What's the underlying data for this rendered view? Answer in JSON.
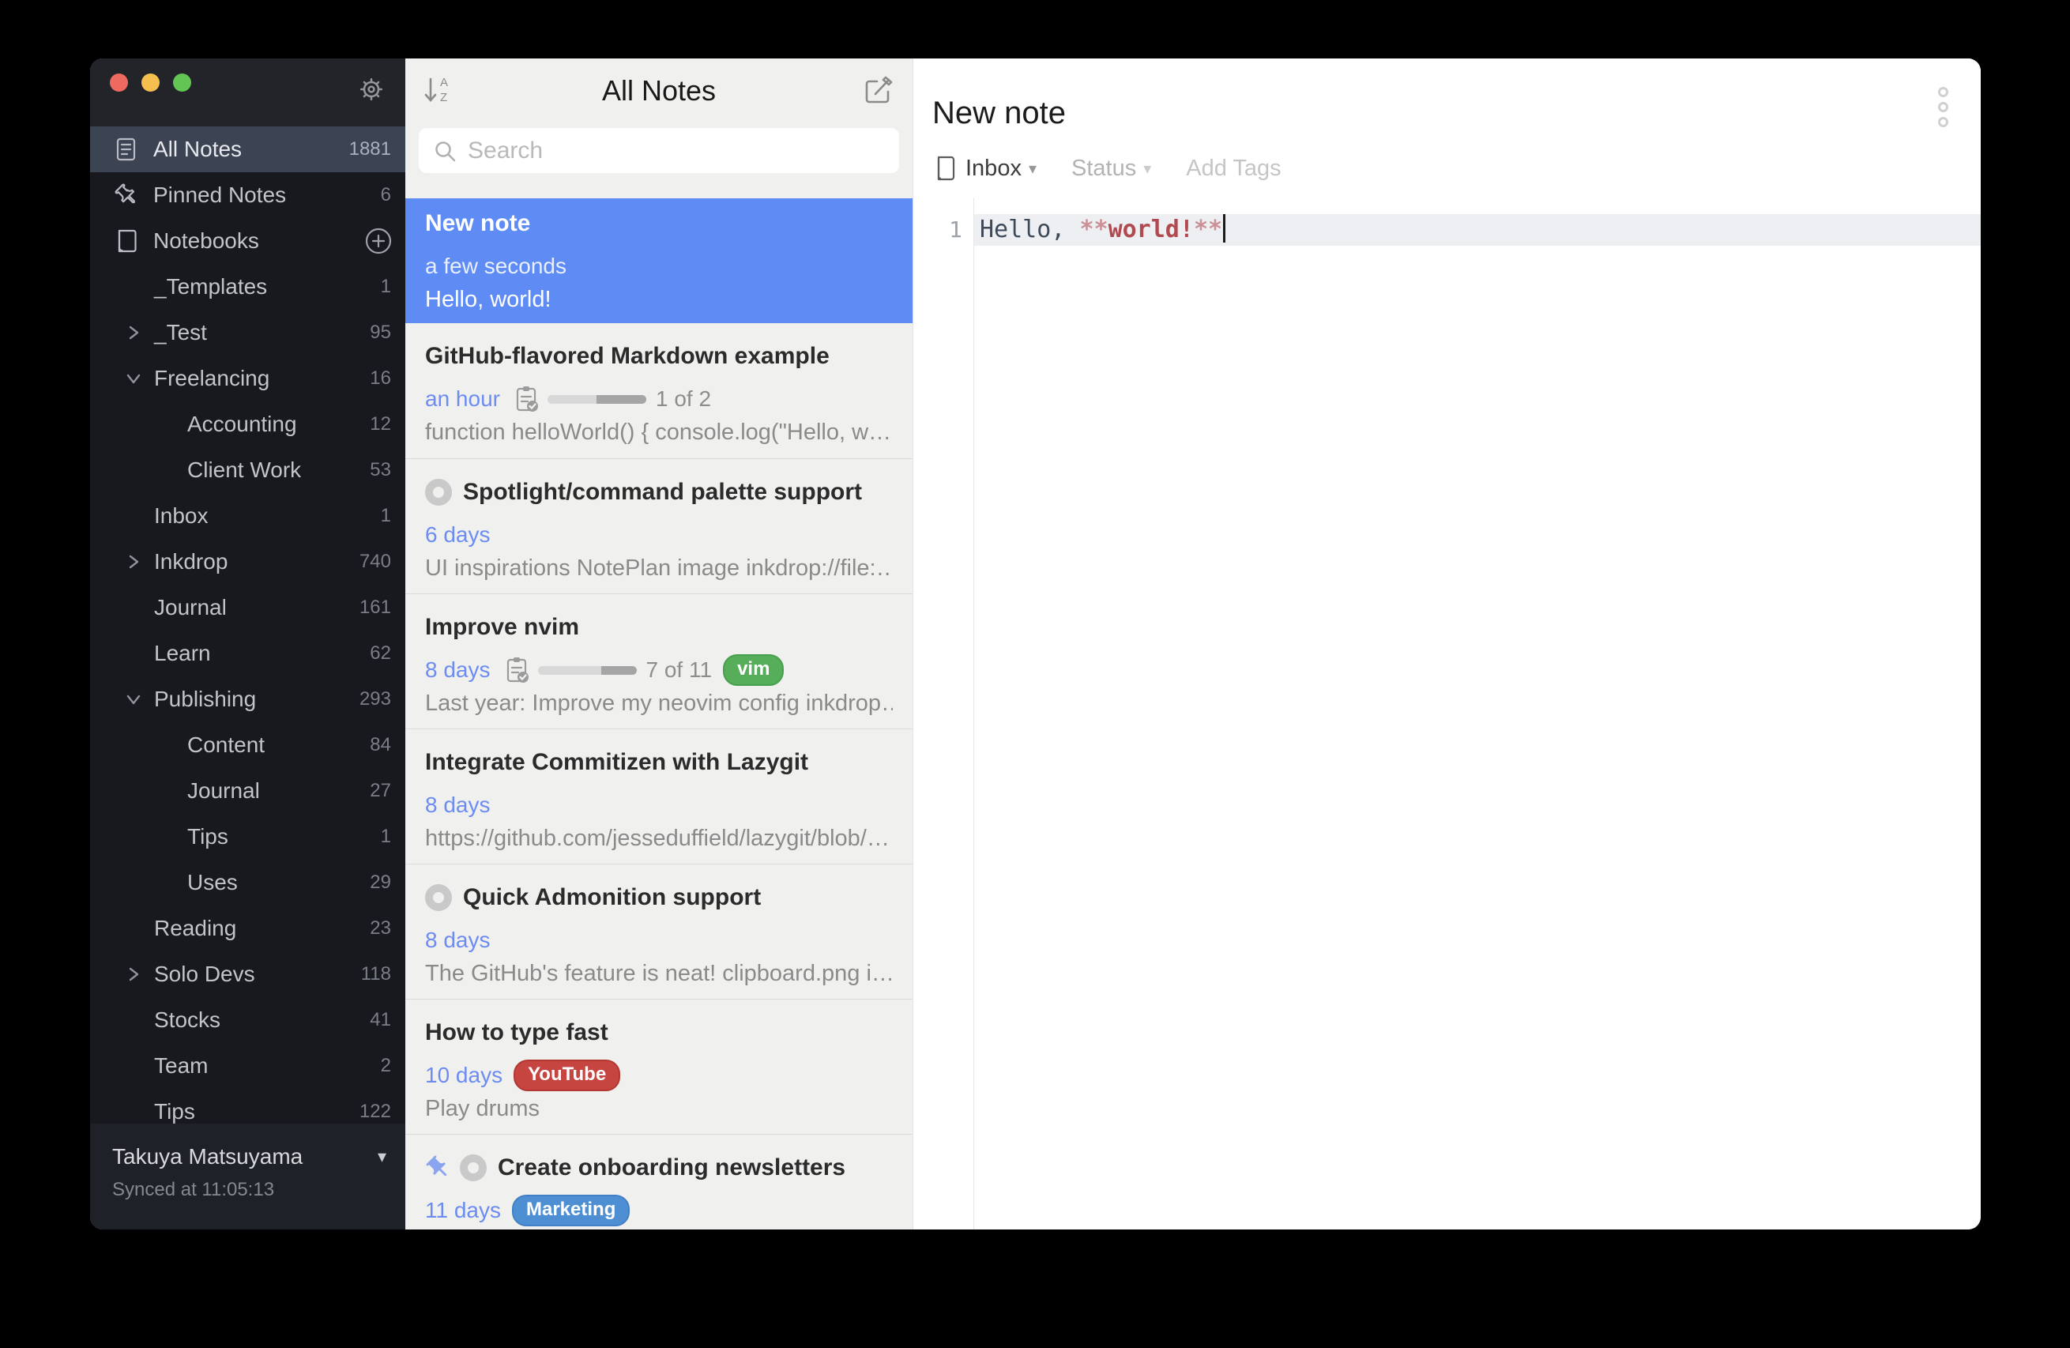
{
  "sidebar": {
    "special_items": [
      {
        "label": "All Notes",
        "count": "1881",
        "icon": "notes-icon",
        "selected": true
      },
      {
        "label": "Pinned Notes",
        "count": "6",
        "icon": "pin-icon",
        "selected": false
      }
    ],
    "notebooks_header": {
      "label": "Notebooks"
    },
    "tree": [
      {
        "label": "_Templates",
        "count": "1",
        "level": 1,
        "chevron": null
      },
      {
        "label": "_Test",
        "count": "95",
        "level": 1,
        "chevron": "right"
      },
      {
        "label": "Freelancing",
        "count": "16",
        "level": 1,
        "chevron": "down"
      },
      {
        "label": "Accounting",
        "count": "12",
        "level": 2,
        "chevron": null
      },
      {
        "label": "Client Work",
        "count": "53",
        "level": 2,
        "chevron": null
      },
      {
        "label": "Inbox",
        "count": "1",
        "level": 1,
        "chevron": null
      },
      {
        "label": "Inkdrop",
        "count": "740",
        "level": 1,
        "chevron": "right"
      },
      {
        "label": "Journal",
        "count": "161",
        "level": 1,
        "chevron": null
      },
      {
        "label": "Learn",
        "count": "62",
        "level": 1,
        "chevron": null
      },
      {
        "label": "Publishing",
        "count": "293",
        "level": 1,
        "chevron": "down"
      },
      {
        "label": "Content",
        "count": "84",
        "level": 2,
        "chevron": null
      },
      {
        "label": "Journal",
        "count": "27",
        "level": 2,
        "chevron": null
      },
      {
        "label": "Tips",
        "count": "1",
        "level": 2,
        "chevron": null
      },
      {
        "label": "Uses",
        "count": "29",
        "level": 2,
        "chevron": null
      },
      {
        "label": "Reading",
        "count": "23",
        "level": 1,
        "chevron": null
      },
      {
        "label": "Solo Devs",
        "count": "118",
        "level": 1,
        "chevron": "right"
      },
      {
        "label": "Stocks",
        "count": "41",
        "level": 1,
        "chevron": null
      },
      {
        "label": "Team",
        "count": "2",
        "level": 1,
        "chevron": null
      },
      {
        "label": "Tips",
        "count": "122",
        "level": 1,
        "chevron": null
      }
    ],
    "footer": {
      "name": "Takuya Matsuyama",
      "synced": "Synced at 11:05:13"
    }
  },
  "note_list": {
    "title": "All Notes",
    "search_placeholder": "Search",
    "items": [
      {
        "title": "New note",
        "time": "a few seconds",
        "preview": "Hello, world!",
        "selected": true,
        "pinned": false,
        "status_icon": false
      },
      {
        "title": "GitHub-flavored Markdown example",
        "time": "an hour",
        "tasks": {
          "done": 1,
          "total": 2,
          "label": "1 of 2"
        },
        "preview": "function helloWorld() { console.log(\"Hello, w…",
        "selected": false,
        "pinned": false,
        "status_icon": false
      },
      {
        "title": "Spotlight/command palette support",
        "time": "6 days",
        "preview": "UI inspirations NotePlan image inkdrop://file:…",
        "selected": false,
        "pinned": false,
        "status_icon": true
      },
      {
        "title": "Improve nvim",
        "time": "8 days",
        "tasks": {
          "done": 7,
          "total": 11,
          "label": "7 of 11"
        },
        "tag": {
          "label": "vim",
          "color": "#56ad5a",
          "border": "#47a04c"
        },
        "preview": "Last year: Improve my neovim config inkdrop…",
        "selected": false,
        "pinned": false,
        "status_icon": false
      },
      {
        "title": "Integrate Commitizen with Lazygit",
        "time": "8 days",
        "preview": "https://github.com/jesseduffield/lazygit/blob/…",
        "selected": false,
        "pinned": false,
        "status_icon": false
      },
      {
        "title": "Quick Admonition support",
        "time": "8 days",
        "preview": "The GitHub's feature is neat! clipboard.png i…",
        "selected": false,
        "pinned": false,
        "status_icon": true
      },
      {
        "title": "How to type fast",
        "time": "10 days",
        "tag": {
          "label": "YouTube",
          "color": "#c64540",
          "border": "#b23832"
        },
        "preview": "Play drums",
        "selected": false,
        "pinned": false,
        "status_icon": false
      },
      {
        "title": "Create onboarding newsletters",
        "time": "11 days",
        "tag": {
          "label": "Marketing",
          "color": "#4e8fd4",
          "border": "#4180c4"
        },
        "preview": "",
        "selected": false,
        "pinned": true,
        "status_icon": true
      }
    ]
  },
  "editor": {
    "title": "New note",
    "notebook": "Inbox",
    "status_label": "Status",
    "add_tags_label": "Add Tags",
    "line_number": "1",
    "code": {
      "prefix": "Hello, ",
      "marker_open": "**",
      "strong": "world!",
      "marker_close": "**"
    }
  },
  "colors": {
    "selection_blue": "#5e8cf4",
    "time_link_blue": "#6d8cf2",
    "sidebar_bg": "#17191e",
    "sidebar_selected": "#3c4352",
    "list_bg": "#f0f0ee",
    "traffic_red": "#ee6a5f",
    "traffic_yellow": "#f5bf4f",
    "traffic_green": "#62c554"
  }
}
